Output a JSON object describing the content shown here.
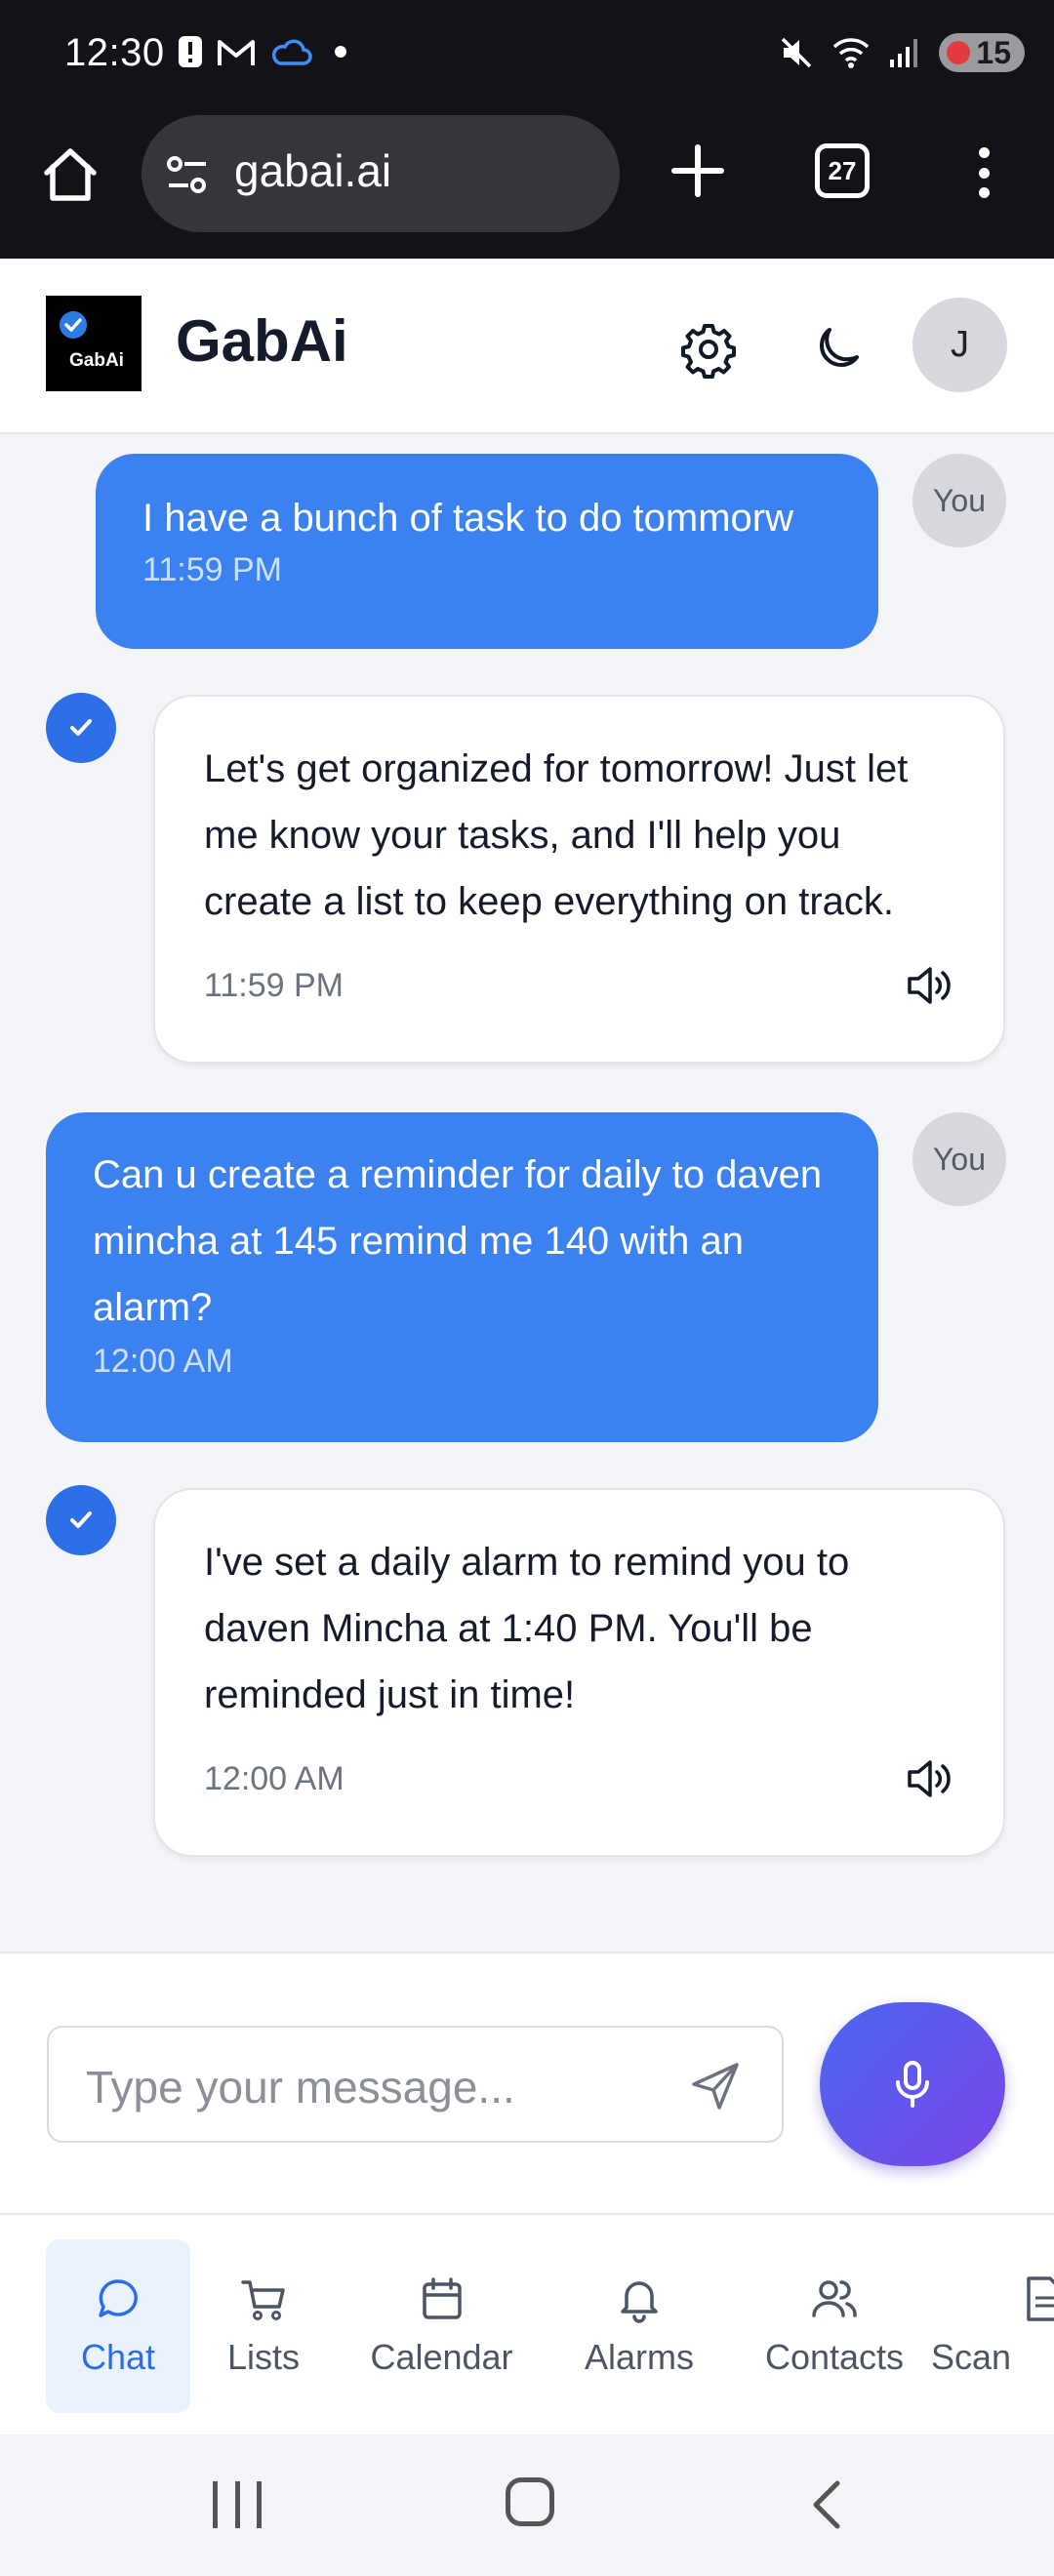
{
  "status_bar": {
    "time": "12:30",
    "battery": "15",
    "icons": [
      "alert-icon",
      "gmail-icon",
      "cloud-icon",
      "dot-icon",
      "mute-icon",
      "wifi-icon",
      "signal-icon",
      "battery-icon"
    ]
  },
  "browser": {
    "url": "gabai.ai",
    "tab_count": "27"
  },
  "app": {
    "title": "GabAi",
    "logo_text": "GabAi",
    "avatar_initial": "J",
    "accent_color": "#3b82f0"
  },
  "messages": [
    {
      "role": "user",
      "badge": "You",
      "text": "I have a bunch of task to do tommorw",
      "time": "11:59 PM"
    },
    {
      "role": "assistant",
      "text": "Let's get organized for tomorrow! Just let me know your tasks, and I'll help you create a list to keep everything on track.",
      "time": "11:59 PM"
    },
    {
      "role": "user",
      "badge": "You",
      "text": "Can u create a reminder for daily to daven mincha at 145 remind me 140 with an alarm?",
      "time": "12:00 AM"
    },
    {
      "role": "assistant",
      "text": "I've set a daily alarm to remind you to daven Mincha at 1:40 PM. You'll be reminded just in time!",
      "time": "12:00 AM"
    }
  ],
  "composer": {
    "placeholder": "Type your message..."
  },
  "bottom_nav": {
    "items": [
      {
        "label": "Chat",
        "icon": "chat-icon",
        "active": true
      },
      {
        "label": "Lists",
        "icon": "cart-icon",
        "active": false
      },
      {
        "label": "Calendar",
        "icon": "calendar-icon",
        "active": false
      },
      {
        "label": "Alarms",
        "icon": "bell-icon",
        "active": false
      },
      {
        "label": "Contacts",
        "icon": "contacts-icon",
        "active": false
      },
      {
        "label": "Scan",
        "icon": "document-icon",
        "active": false
      }
    ]
  }
}
